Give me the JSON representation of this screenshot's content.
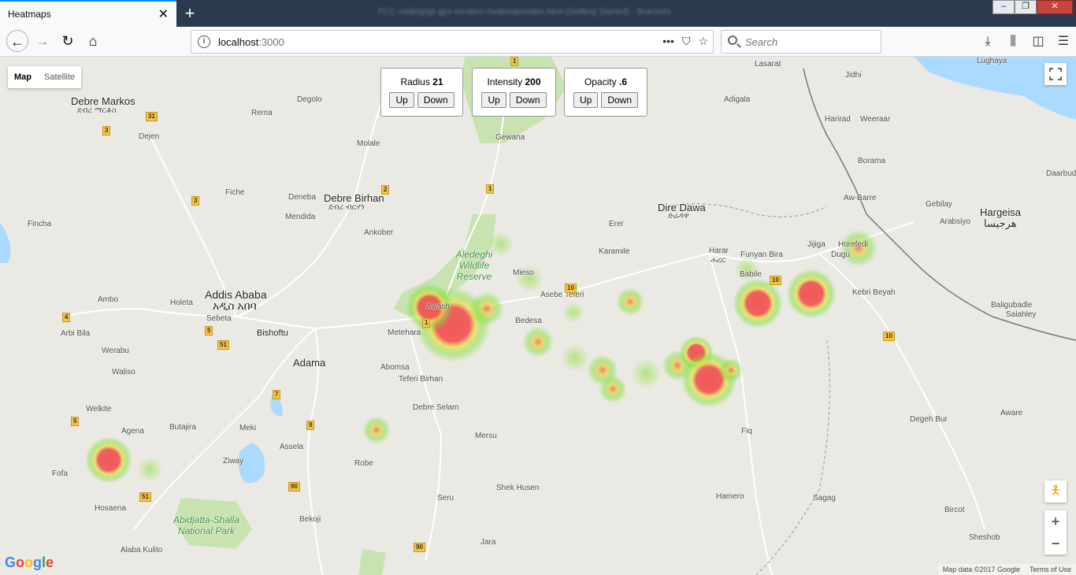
{
  "browser": {
    "tab_title": "Heatmaps",
    "tab_close": "✕",
    "new_tab": "+",
    "window_title": "FCC coding/git gpx-location-heatmap/index.html (Getting Started) - Brackets",
    "url_host": "localhost",
    "url_port": ":3000",
    "search_placeholder": "Search",
    "win_min": "–",
    "win_max": "❐",
    "win_close": "✕"
  },
  "map_controls": {
    "map_type": {
      "map": "Map",
      "satellite": "Satellite"
    },
    "radius": {
      "label": "Radius",
      "value": "21",
      "up": "Up",
      "down": "Down"
    },
    "intensity": {
      "label": "Intensity",
      "value": "200",
      "up": "Up",
      "down": "Down"
    },
    "opacity": {
      "label": "Opacity",
      "value": ".6",
      "up": "Up",
      "down": "Down"
    },
    "zoom_in": "+",
    "zoom_out": "−"
  },
  "attribution": {
    "logo": "Google",
    "map_data": "Map data ©2017 Google",
    "terms": "Terms of Use"
  },
  "places": [
    "Debre Markos",
    "ደብረ ማርቆስ",
    "Degolo",
    "Rema",
    "Dejen",
    "Molale",
    "Debre Birhan",
    "ደብረ ብርሃን",
    "Fiche",
    "Deneba",
    "Mendida",
    "Ankober",
    "Fincha",
    "Ambo",
    "Holeta",
    "Addis Ababa",
    "አዲስ አበባ",
    "Sebeta",
    "Bishoftu",
    "Arbi Bila",
    "Werabu",
    "Waliso",
    "Adama",
    "Welkite",
    "Agena",
    "Butajira",
    "Meki",
    "Assela",
    "Fofa",
    "Ziway",
    "Robe",
    "Hosaena",
    "Bekoji",
    "Alaba Kulito",
    "Aledeghi Wildlife Reserve",
    "Abidjatta-Shalla National Park",
    "Awash",
    "Metehara",
    "Mieso",
    "Asebe Teferi",
    "Bedesa",
    "Abomsa",
    "Teferi Birhan",
    "Debre Selam",
    "Mersu",
    "Shek Husen",
    "Seru",
    "Jara",
    "Gewana",
    "Dire Dawa",
    "ድሬዳዋ",
    "Erer",
    "Karamile",
    "Harar",
    "ሐረር",
    "Funyan Bira",
    "Babile",
    "Jijiga",
    "Hamero",
    "Fiq",
    "Sagag",
    "Degeh Bur",
    "Aware",
    "Kebri Beyah",
    "Bircot",
    "Sheshob",
    "Adigala",
    "Lasarat",
    "Jidhi",
    "Harirad",
    "Weeraar",
    "Borama",
    "Aw-Barre",
    "Gebilay",
    "Arabsiyo",
    "Hargeisa",
    "هرجيسا",
    "Lughaya",
    "Daarbud",
    "Baligubadle",
    "Salahley",
    "Horefedi",
    "Dugu"
  ]
}
